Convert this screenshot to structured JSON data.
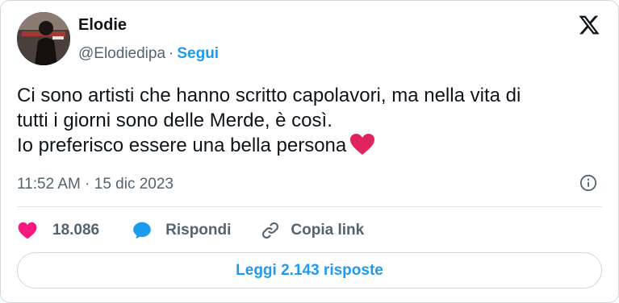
{
  "author": {
    "display_name": "Elodie",
    "handle": "@Elodiedipa",
    "separator": "·",
    "follow_label": "Segui"
  },
  "tweet": {
    "lines": [
      "Ci sono artisti che hanno scritto capolavori, ma nella vita di",
      "tutti i giorni sono delle Merde, è così.",
      "Io preferisco essere una bella persona"
    ],
    "trailing_emoji": "red-heart",
    "timestamp": "11:52 AM · 15 dic 2023"
  },
  "actions": {
    "like_count": "18.086",
    "reply_label": "Rispondi",
    "copy_link_label": "Copia link"
  },
  "replies_button_label": "Leggi 2.143 risposte",
  "colors": {
    "accent": "#1d9bf0",
    "like": "#f91880",
    "muted": "#536471",
    "text": "#0f1419",
    "emoji_heart": "#e0245e"
  },
  "icons": {
    "brand": "x-logo-icon",
    "info": "info-icon",
    "like": "heart-icon",
    "reply": "speech-bubble-icon",
    "copy": "link-icon"
  }
}
